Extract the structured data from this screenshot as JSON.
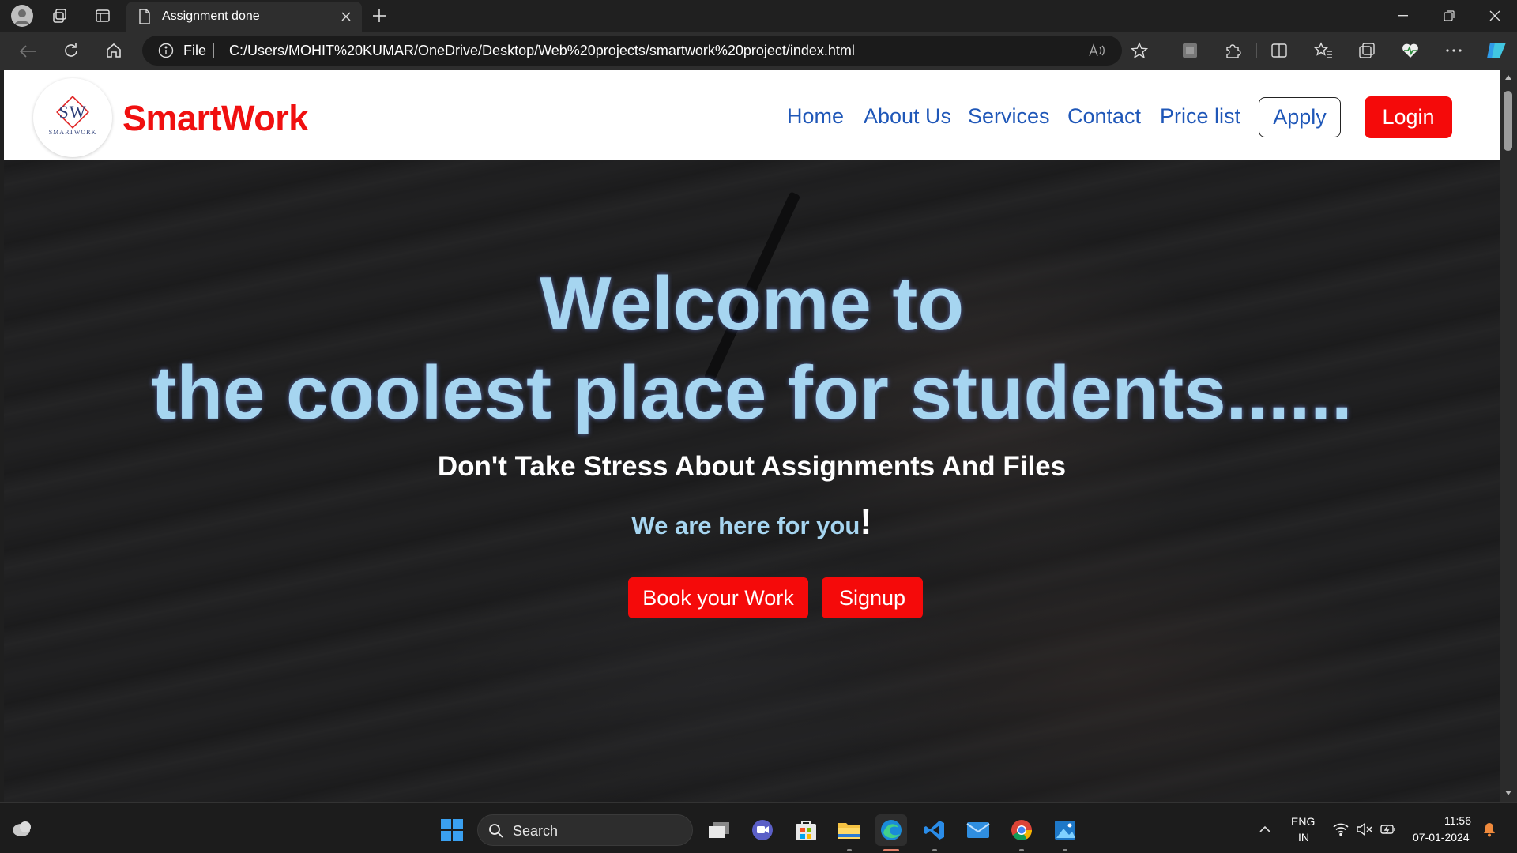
{
  "browser": {
    "tab_title": "Assignment done",
    "address_scheme_label": "File",
    "url": "C:/Users/MOHIT%20KUMAR/OneDrive/Desktop/Web%20projects/smartwork%20project/index.html"
  },
  "site": {
    "logo_initials": "SW",
    "logo_caption": "SMARTWORK",
    "brand": "SmartWork",
    "nav": [
      "Home",
      "About Us",
      "Services",
      "Contact",
      "Price list"
    ],
    "apply_label": "Apply",
    "login_label": "Login",
    "hero": {
      "title_line1": "Welcome to",
      "title_line2": "the coolest place for students......",
      "subtitle": "Don't Take Stress About Assignments And Files",
      "tagline": "We are here for you",
      "tagline_mark": "!",
      "book_label": "Book your Work",
      "signup_label": "Signup"
    }
  },
  "taskbar": {
    "search_label": "Search",
    "lang_line1": "ENG",
    "lang_line2": "IN",
    "time": "11:56",
    "date": "07-01-2024"
  },
  "colors": {
    "brand_red": "#f01010",
    "nav_blue": "#1f57b8",
    "hero_text": "#a6d5f0"
  }
}
